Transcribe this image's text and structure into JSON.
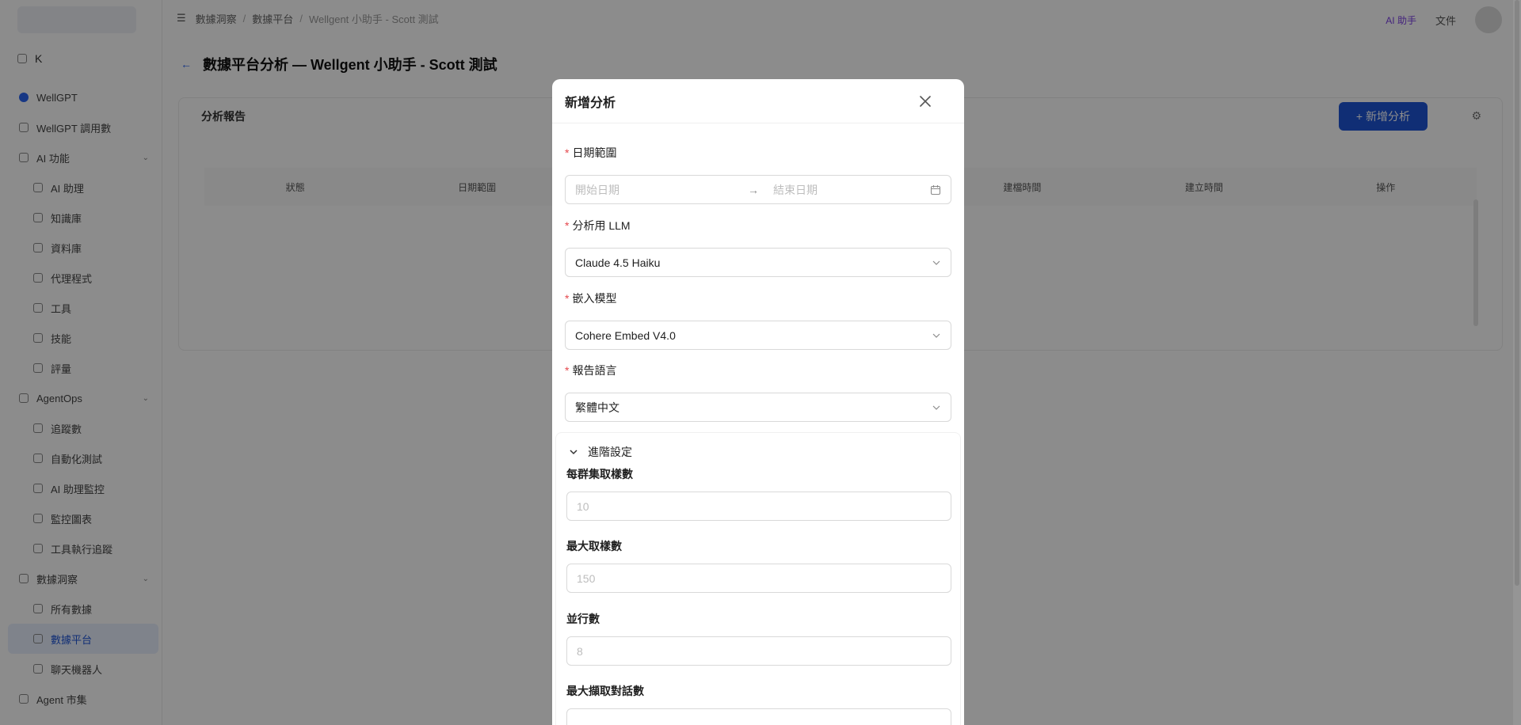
{
  "app": {
    "sidebar": {
      "top_label": "K",
      "items": [
        {
          "label": "WellGPT",
          "level": 0
        },
        {
          "label": "WellGPT 調用數",
          "level": 0
        },
        {
          "label": "AI 功能",
          "level": 0,
          "expandable": true
        },
        {
          "label": "AI 助理",
          "level": 1
        },
        {
          "label": "知識庫",
          "level": 1
        },
        {
          "label": "資料庫",
          "level": 1
        },
        {
          "label": "代理程式",
          "level": 1
        },
        {
          "label": "工具",
          "level": 1
        },
        {
          "label": "技能",
          "level": 1
        },
        {
          "label": "評量",
          "level": 1
        },
        {
          "label": "AgentOps",
          "level": 0,
          "expandable": true
        },
        {
          "label": "追蹤數",
          "level": 1
        },
        {
          "label": "自動化測試",
          "level": 1
        },
        {
          "label": "AI 助理監控",
          "level": 1
        },
        {
          "label": "監控圖表",
          "level": 1
        },
        {
          "label": "工具執行追蹤",
          "level": 1
        },
        {
          "label": "數據洞察",
          "level": 0,
          "expandable": true
        },
        {
          "label": "所有數據",
          "level": 1
        },
        {
          "label": "數據平台",
          "level": 1,
          "active": true
        },
        {
          "label": "聊天機器人",
          "level": 1
        },
        {
          "label": "Agent 市集",
          "level": 0
        }
      ]
    },
    "topbar": {
      "breadcrumb": [
        "數據洞察",
        "數據平台",
        "Wellgent 小助手 - Scott 測試"
      ],
      "purple_text": "AI 助手",
      "lang_text": "文件"
    },
    "page_title": "數據平台分析 — Wellgent 小助手 - Scott 測試",
    "card": {
      "title": "分析報告",
      "primary_button": "+ 新增分析",
      "columns": [
        "狀態",
        "日期範圍",
        "",
        "",
        "建檔時間",
        "建立時間",
        "操作"
      ]
    }
  },
  "modal": {
    "title": "新增分析",
    "date_range": {
      "label": "日期範圍",
      "start_placeholder": "開始日期",
      "end_placeholder": "結束日期"
    },
    "llm": {
      "label": "分析用 LLM",
      "value": "Claude 4.5 Haiku"
    },
    "embedding": {
      "label": "嵌入模型",
      "value": "Cohere Embed V4.0"
    },
    "language": {
      "label": "報告語言",
      "value": "繁體中文"
    },
    "advanced": {
      "toggle_label": "進階設定",
      "samples_per_cluster": {
        "label": "每群集取樣數",
        "placeholder": "10"
      },
      "max_samples": {
        "label": "最大取樣數",
        "placeholder": "150"
      },
      "concurrency": {
        "label": "並行數",
        "placeholder": "8"
      },
      "max_conversations": {
        "label": "最大擷取對話數",
        "placeholder": ""
      }
    }
  },
  "colors": {
    "required": "#e5484d",
    "primary": "#1e54d6",
    "mask": "rgba(0,0,0,0.45)"
  }
}
